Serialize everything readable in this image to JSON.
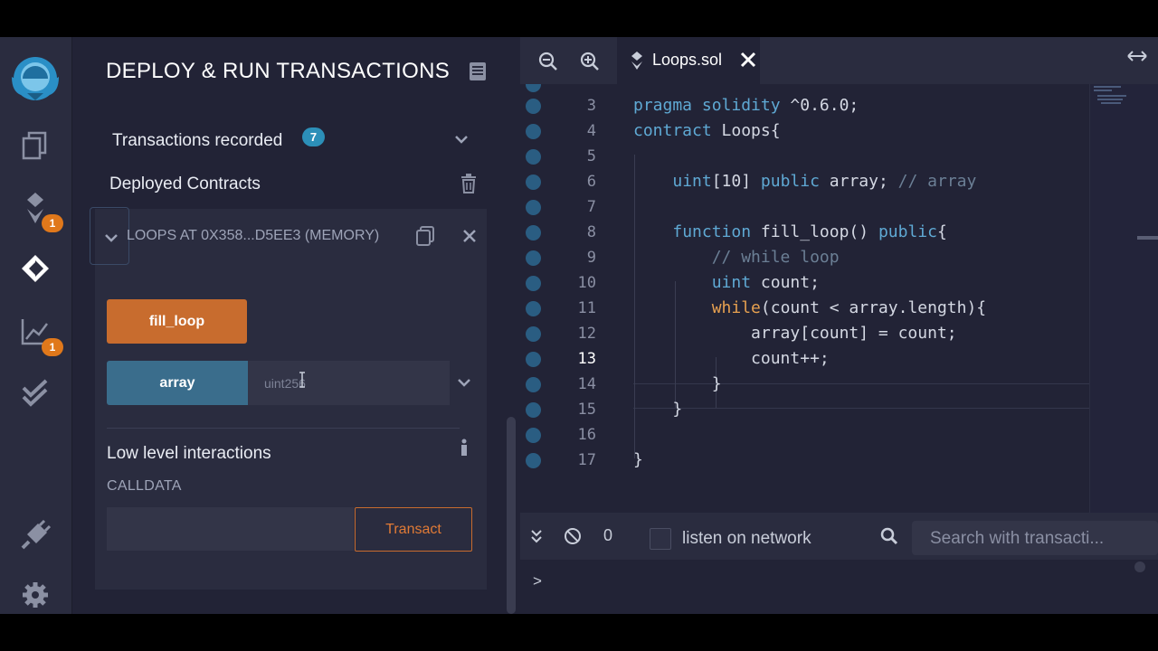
{
  "sidebar": {
    "plugins": [
      {
        "name": "file-explorer"
      },
      {
        "name": "solidity-compiler",
        "badge": "1"
      },
      {
        "name": "deploy-run",
        "active": true
      },
      {
        "name": "analysis",
        "badge": "1"
      },
      {
        "name": "unit-testing"
      }
    ]
  },
  "panel": {
    "title": "DEPLOY & RUN TRANSACTIONS",
    "transactions_label": "Transactions recorded",
    "transactions_count": "7",
    "deployed_label": "Deployed Contracts",
    "contract_name": "LOOPS AT 0X358...D5EE3 (MEMORY)",
    "fill_loop_label": "fill_loop",
    "array_label": "array",
    "array_placeholder": "uint256",
    "low_level_label": "Low level interactions",
    "calldata_label": "CALLDATA",
    "transact_label": "Transact"
  },
  "editor": {
    "tab_label": "Loops.sol",
    "active_line": 13,
    "line_numbers": [
      "3",
      "4",
      "5",
      "6",
      "7",
      "8",
      "9",
      "10",
      "11",
      "12",
      "13",
      "14",
      "15",
      "16",
      "17"
    ]
  },
  "terminal": {
    "count": "0",
    "listen_label": "listen on network",
    "search_placeholder": "Search with transacti...",
    "prompt": ">"
  },
  "colors": {
    "accent_orange": "#c86c2e",
    "accent_blue": "#3a6d8c",
    "badge": "#e0781b",
    "bg": "#222336"
  }
}
